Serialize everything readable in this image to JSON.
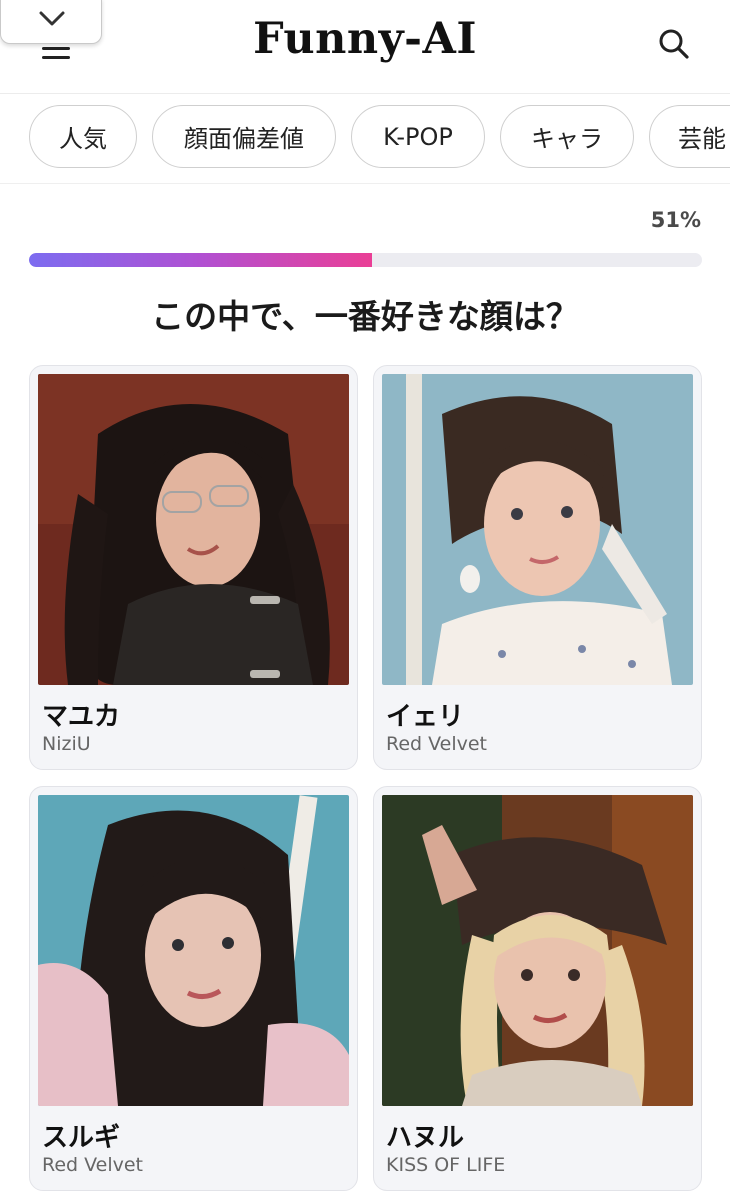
{
  "header": {
    "brand": "Funny-AI",
    "menu_icon": "hamburger-menu-icon",
    "collapse_icon": "chevron-down-icon",
    "search_icon": "search-icon"
  },
  "categories": [
    "人気",
    "顔面偏差値",
    "K-POP",
    "キャラ",
    "芸能"
  ],
  "progress": {
    "percent_label": "51%",
    "value": 0.51,
    "gradient": [
      "#7c6cf0",
      "#b150d2",
      "#ea3f96"
    ]
  },
  "question": "この中で、一番好きな顔は？",
  "candidates": [
    {
      "name": "マユカ",
      "group": "NiziU"
    },
    {
      "name": "イェリ",
      "group": "Red Velvet"
    },
    {
      "name": "スルギ",
      "group": "Red Velvet"
    },
    {
      "name": "ハヌル",
      "group": "KISS OF LIFE"
    }
  ]
}
